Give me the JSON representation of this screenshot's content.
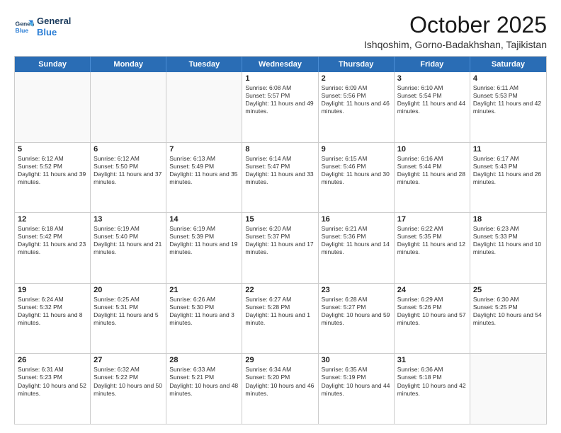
{
  "logo": {
    "line1": "General",
    "line2": "Blue"
  },
  "title": "October 2025",
  "subtitle": "Ishqoshim, Gorno-Badakhshan, Tajikistan",
  "days_of_week": [
    "Sunday",
    "Monday",
    "Tuesday",
    "Wednesday",
    "Thursday",
    "Friday",
    "Saturday"
  ],
  "weeks": [
    [
      {
        "day": "",
        "text": ""
      },
      {
        "day": "",
        "text": ""
      },
      {
        "day": "",
        "text": ""
      },
      {
        "day": "1",
        "text": "Sunrise: 6:08 AM\nSunset: 5:57 PM\nDaylight: 11 hours and 49 minutes."
      },
      {
        "day": "2",
        "text": "Sunrise: 6:09 AM\nSunset: 5:56 PM\nDaylight: 11 hours and 46 minutes."
      },
      {
        "day": "3",
        "text": "Sunrise: 6:10 AM\nSunset: 5:54 PM\nDaylight: 11 hours and 44 minutes."
      },
      {
        "day": "4",
        "text": "Sunrise: 6:11 AM\nSunset: 5:53 PM\nDaylight: 11 hours and 42 minutes."
      }
    ],
    [
      {
        "day": "5",
        "text": "Sunrise: 6:12 AM\nSunset: 5:52 PM\nDaylight: 11 hours and 39 minutes."
      },
      {
        "day": "6",
        "text": "Sunrise: 6:12 AM\nSunset: 5:50 PM\nDaylight: 11 hours and 37 minutes."
      },
      {
        "day": "7",
        "text": "Sunrise: 6:13 AM\nSunset: 5:49 PM\nDaylight: 11 hours and 35 minutes."
      },
      {
        "day": "8",
        "text": "Sunrise: 6:14 AM\nSunset: 5:47 PM\nDaylight: 11 hours and 33 minutes."
      },
      {
        "day": "9",
        "text": "Sunrise: 6:15 AM\nSunset: 5:46 PM\nDaylight: 11 hours and 30 minutes."
      },
      {
        "day": "10",
        "text": "Sunrise: 6:16 AM\nSunset: 5:44 PM\nDaylight: 11 hours and 28 minutes."
      },
      {
        "day": "11",
        "text": "Sunrise: 6:17 AM\nSunset: 5:43 PM\nDaylight: 11 hours and 26 minutes."
      }
    ],
    [
      {
        "day": "12",
        "text": "Sunrise: 6:18 AM\nSunset: 5:42 PM\nDaylight: 11 hours and 23 minutes."
      },
      {
        "day": "13",
        "text": "Sunrise: 6:19 AM\nSunset: 5:40 PM\nDaylight: 11 hours and 21 minutes."
      },
      {
        "day": "14",
        "text": "Sunrise: 6:19 AM\nSunset: 5:39 PM\nDaylight: 11 hours and 19 minutes."
      },
      {
        "day": "15",
        "text": "Sunrise: 6:20 AM\nSunset: 5:37 PM\nDaylight: 11 hours and 17 minutes."
      },
      {
        "day": "16",
        "text": "Sunrise: 6:21 AM\nSunset: 5:36 PM\nDaylight: 11 hours and 14 minutes."
      },
      {
        "day": "17",
        "text": "Sunrise: 6:22 AM\nSunset: 5:35 PM\nDaylight: 11 hours and 12 minutes."
      },
      {
        "day": "18",
        "text": "Sunrise: 6:23 AM\nSunset: 5:33 PM\nDaylight: 11 hours and 10 minutes."
      }
    ],
    [
      {
        "day": "19",
        "text": "Sunrise: 6:24 AM\nSunset: 5:32 PM\nDaylight: 11 hours and 8 minutes."
      },
      {
        "day": "20",
        "text": "Sunrise: 6:25 AM\nSunset: 5:31 PM\nDaylight: 11 hours and 5 minutes."
      },
      {
        "day": "21",
        "text": "Sunrise: 6:26 AM\nSunset: 5:30 PM\nDaylight: 11 hours and 3 minutes."
      },
      {
        "day": "22",
        "text": "Sunrise: 6:27 AM\nSunset: 5:28 PM\nDaylight: 11 hours and 1 minute."
      },
      {
        "day": "23",
        "text": "Sunrise: 6:28 AM\nSunset: 5:27 PM\nDaylight: 10 hours and 59 minutes."
      },
      {
        "day": "24",
        "text": "Sunrise: 6:29 AM\nSunset: 5:26 PM\nDaylight: 10 hours and 57 minutes."
      },
      {
        "day": "25",
        "text": "Sunrise: 6:30 AM\nSunset: 5:25 PM\nDaylight: 10 hours and 54 minutes."
      }
    ],
    [
      {
        "day": "26",
        "text": "Sunrise: 6:31 AM\nSunset: 5:23 PM\nDaylight: 10 hours and 52 minutes."
      },
      {
        "day": "27",
        "text": "Sunrise: 6:32 AM\nSunset: 5:22 PM\nDaylight: 10 hours and 50 minutes."
      },
      {
        "day": "28",
        "text": "Sunrise: 6:33 AM\nSunset: 5:21 PM\nDaylight: 10 hours and 48 minutes."
      },
      {
        "day": "29",
        "text": "Sunrise: 6:34 AM\nSunset: 5:20 PM\nDaylight: 10 hours and 46 minutes."
      },
      {
        "day": "30",
        "text": "Sunrise: 6:35 AM\nSunset: 5:19 PM\nDaylight: 10 hours and 44 minutes."
      },
      {
        "day": "31",
        "text": "Sunrise: 6:36 AM\nSunset: 5:18 PM\nDaylight: 10 hours and 42 minutes."
      },
      {
        "day": "",
        "text": ""
      }
    ]
  ]
}
